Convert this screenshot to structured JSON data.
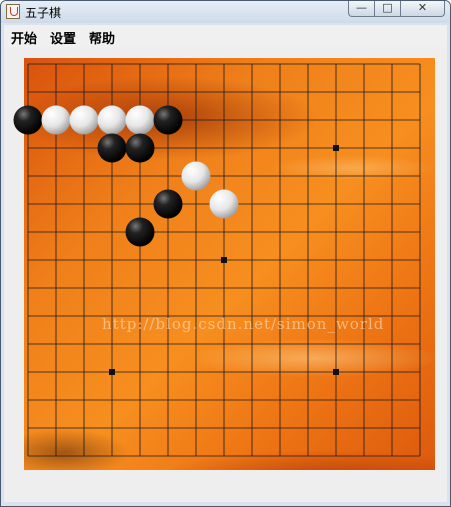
{
  "window": {
    "title": "五子棋",
    "controls": {
      "minimize": "—",
      "maximize": "□",
      "close": "✕"
    }
  },
  "menu": {
    "items": [
      "开始",
      "设置",
      "帮助"
    ]
  },
  "board": {
    "size": 15,
    "star_points": [
      [
        3,
        3
      ],
      [
        11,
        3
      ],
      [
        7,
        7
      ],
      [
        3,
        11
      ],
      [
        11,
        11
      ]
    ],
    "stones": [
      {
        "col": 0,
        "row": 2,
        "color": "black"
      },
      {
        "col": 1,
        "row": 2,
        "color": "white"
      },
      {
        "col": 2,
        "row": 2,
        "color": "white"
      },
      {
        "col": 3,
        "row": 2,
        "color": "white"
      },
      {
        "col": 4,
        "row": 2,
        "color": "white"
      },
      {
        "col": 5,
        "row": 2,
        "color": "black"
      },
      {
        "col": 3,
        "row": 3,
        "color": "black"
      },
      {
        "col": 4,
        "row": 3,
        "color": "black"
      },
      {
        "col": 6,
        "row": 4,
        "color": "white"
      },
      {
        "col": 5,
        "row": 5,
        "color": "black"
      },
      {
        "col": 7,
        "row": 5,
        "color": "white"
      },
      {
        "col": 4,
        "row": 6,
        "color": "black"
      }
    ],
    "watermark": "http://blog.csdn.net/simon_world"
  }
}
